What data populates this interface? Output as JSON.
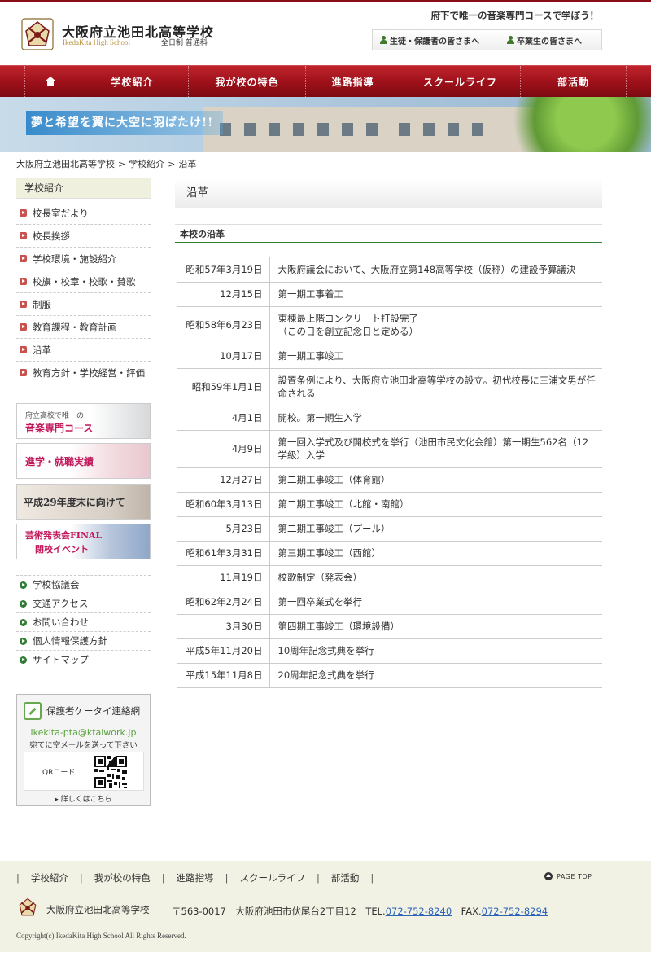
{
  "header": {
    "school_name": "大阪府立池田北高等学校",
    "school_name_en": "IkedaKita High School",
    "course": "全日制 普通科",
    "tagline": "府下で唯一の音楽専門コースで学ぼう！",
    "links": [
      {
        "label": "生徒・保護者の皆さまへ",
        "icon": "person-icon"
      },
      {
        "label": "卒業生の皆さまへ",
        "icon": "person-icon"
      }
    ]
  },
  "nav": {
    "home_icon": "home-icon",
    "items": [
      "学校紹介",
      "我が校の特色",
      "進路指導",
      "スクールライフ",
      "部活動"
    ]
  },
  "banner": {
    "text": "夢と希望を翼に大空に羽ばたけ!!"
  },
  "breadcrumb": [
    "大阪府立池田北高等学校",
    "学校紹介",
    "沿革"
  ],
  "breadcrumb_sep": ">",
  "sidebar": {
    "heading": "学校紹介",
    "items": [
      "校長室だより",
      "校長挨拶",
      "学校環境・施設紹介",
      "校旗・校章・校歌・賛歌",
      "制服",
      "教育課程・教育計画",
      "沿革",
      "教育方針・学校経営・評価"
    ],
    "banners": [
      {
        "line1": "府立高校で唯一の",
        "line2": "音楽専門コース"
      },
      {
        "text": "進学・就職実績"
      },
      {
        "text": "平成29年度末に向けて"
      },
      {
        "line1": "芸術発表会FINAL",
        "line2": "閉校イベント"
      }
    ],
    "links": [
      "学校協議会",
      "交通アクセス",
      "お問い合わせ",
      "個人情報保護方針",
      "サイトマップ"
    ],
    "ktai": {
      "title": "保護者ケータイ連絡網",
      "email": "ikekita-pta@ktaiwork.jp",
      "note": "宛てに空メールを送って下さい",
      "qr_label": "QRコード",
      "more": "▸ 詳しくはこちら"
    }
  },
  "main": {
    "title": "沿革",
    "section_title": "本校の沿革",
    "history": [
      {
        "date": "昭和57年3月19日",
        "event": "大阪府議会において、大阪府立第148高等学校（仮称）の建設予算議決"
      },
      {
        "date": "12月15日",
        "event": "第一期工事着工"
      },
      {
        "date": "昭和58年6月23日",
        "event": "東棟最上階コンクリート打設完了\n（この日を創立記念日と定める）"
      },
      {
        "date": "10月17日",
        "event": "第一期工事竣工"
      },
      {
        "date": "昭和59年1月1日",
        "event": "設置条例により、大阪府立池田北高等学校の設立。初代校長に三浦文男が任命される"
      },
      {
        "date": "4月1日",
        "event": "開校。第一期生入学"
      },
      {
        "date": "4月9日",
        "event": "第一回入学式及び開校式を挙行（池田市民文化会館）第一期生562名（12学級）入学"
      },
      {
        "date": "12月27日",
        "event": "第二期工事竣工（体育館）"
      },
      {
        "date": "昭和60年3月13日",
        "event": "第二期工事竣工（北館・南館）"
      },
      {
        "date": "5月23日",
        "event": "第二期工事竣工（プール）"
      },
      {
        "date": "昭和61年3月31日",
        "event": "第三期工事竣工（西館）"
      },
      {
        "date": "11月19日",
        "event": "校歌制定（発表会）"
      },
      {
        "date": "昭和62年2月24日",
        "event": "第一回卒業式を挙行"
      },
      {
        "date": "3月30日",
        "event": "第四期工事竣工（環境設備）"
      },
      {
        "date": "平成5年11月20日",
        "event": "10周年記念式典を挙行"
      },
      {
        "date": "平成15年11月8日",
        "event": "20周年記念式典を挙行"
      }
    ]
  },
  "footer": {
    "nav": [
      "学校紹介",
      "我が校の特色",
      "進路指導",
      "スクールライフ",
      "部活動"
    ],
    "separator": "|",
    "page_top": "PAGE TOP",
    "school_name": "大阪府立池田北高等学校",
    "address": "〒563-0017　大阪府池田市伏尾台2丁目12",
    "tel_label": "TEL.",
    "tel": "072-752-8240",
    "fax_label": "FAX.",
    "fax": "072-752-8294",
    "copyright": "Copyright(c) IkedaKita High School All Rights Reserved."
  },
  "colors": {
    "brand_red": "#9c1019",
    "accent_green": "#2e7d32",
    "link_blue": "#2a63b8"
  }
}
